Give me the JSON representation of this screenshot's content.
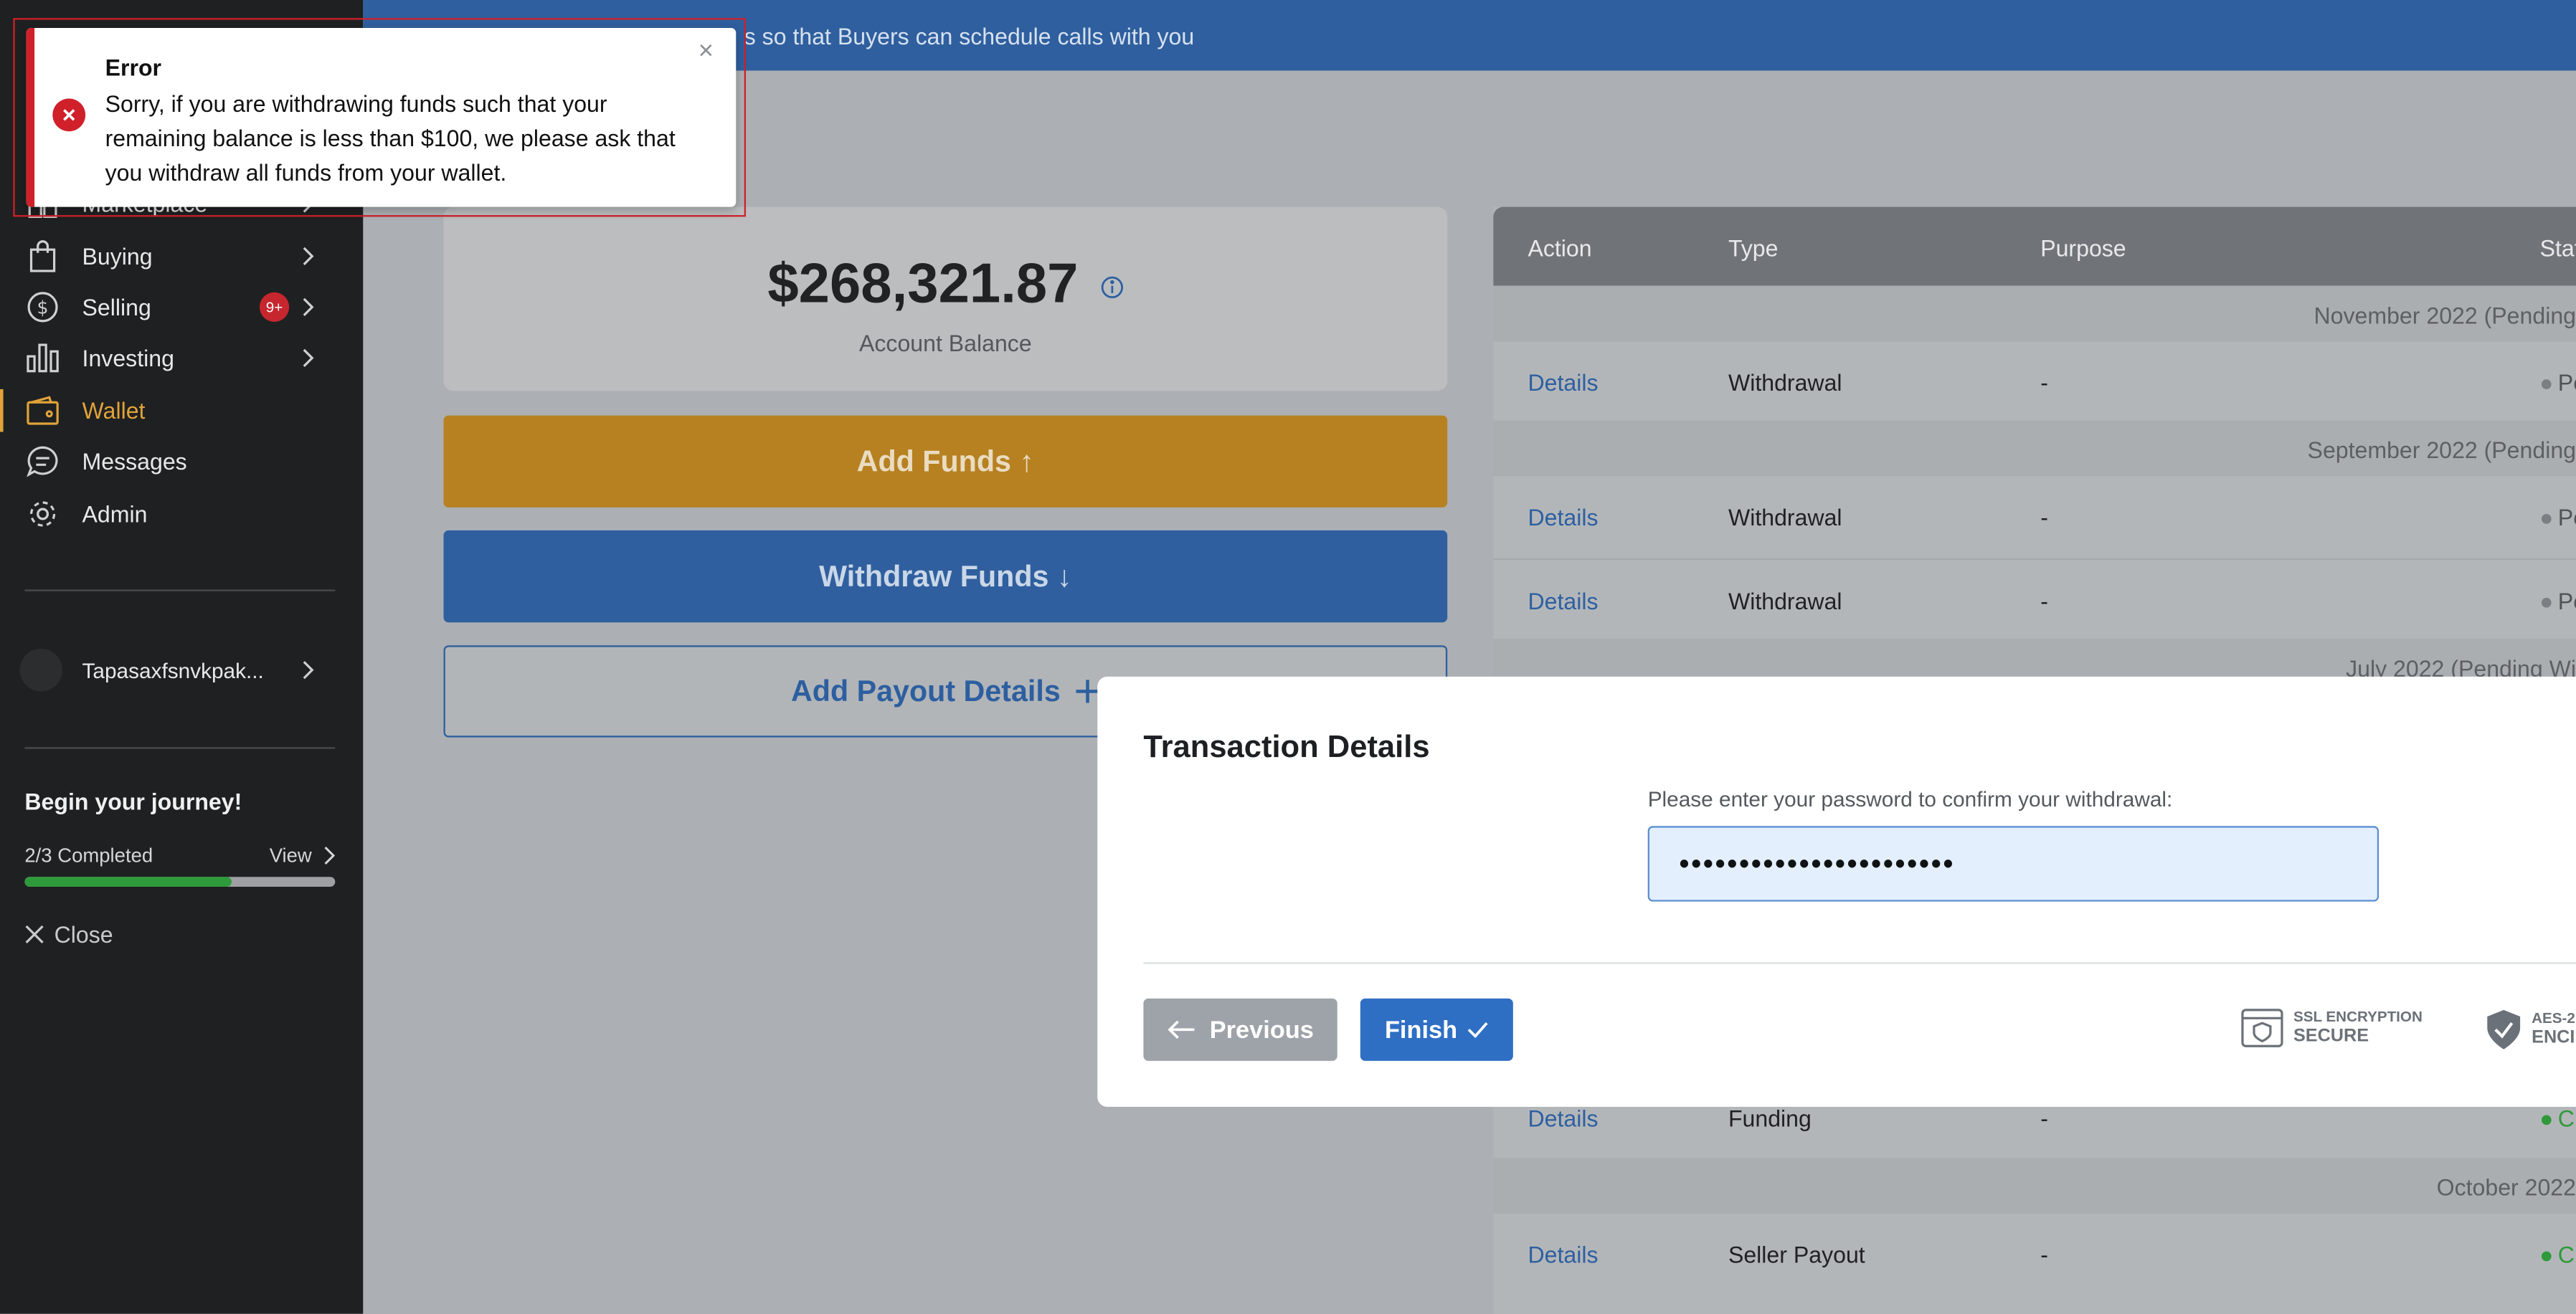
{
  "topbar": {
    "message": "s so that Buyers can schedule calls with you"
  },
  "sidebar": {
    "items": [
      {
        "label": "Marketplace"
      },
      {
        "label": "Buying"
      },
      {
        "label": "Selling",
        "badge": "9+"
      },
      {
        "label": "Investing"
      },
      {
        "label": "Wallet"
      },
      {
        "label": "Messages"
      },
      {
        "label": "Admin"
      }
    ],
    "user": {
      "name": "Tapasaxfsnvkpak..."
    },
    "journey": {
      "title": "Begin your journey!",
      "progress_text": "2/3 Completed",
      "progress": 0.667,
      "view_label": "View"
    },
    "close_label": "Close"
  },
  "wallet": {
    "balance": "$268,321.87",
    "balance_label": "Account Balance",
    "add_funds": "Add Funds ↑",
    "withdraw_funds": "Withdraw Funds ↓",
    "add_payout": "Add Payout Details"
  },
  "table": {
    "headers": [
      "Action",
      "Type",
      "Purpose",
      "Stat"
    ],
    "groups": [
      "November 2022 (Pending",
      "September 2022 (Pending",
      "July 2022 (Pending Wi",
      "October 2022"
    ],
    "rows": [
      {
        "action": "Details",
        "type": "Withdrawal",
        "purpose": "-",
        "status": "Pe"
      },
      {
        "action": "Details",
        "type": "Withdrawal",
        "purpose": "-",
        "status": "Pe"
      },
      {
        "action": "Details",
        "type": "Withdrawal",
        "purpose": "-",
        "status": "Pe"
      },
      {
        "action": "Details",
        "type": "Funding",
        "purpose": "-",
        "status": "C"
      },
      {
        "action": "Details",
        "type": "Seller Payout",
        "purpose": "-",
        "status": "C"
      }
    ]
  },
  "modal": {
    "title": "Transaction Details",
    "prompt": "Please enter your password to confirm your withdrawal:",
    "password_value": "•••••••••••••••••••••••",
    "previous_label": "Previous",
    "finish_label": "Finish",
    "ssl_small": "SSL ENCRYPTION",
    "ssl_big": "SECURE",
    "aes_small": "AES-2",
    "aes_big": "ENCI"
  },
  "toast": {
    "title": "Error",
    "message": "Sorry, if you are withdrawing funds such that your remaining balance is less than $100, we please ask that you withdraw all funds from your wallet."
  },
  "colors": {
    "accent": "#e0a33a",
    "primary": "#2e6fc4",
    "error": "#d0202a",
    "success": "#2f9a3b"
  }
}
